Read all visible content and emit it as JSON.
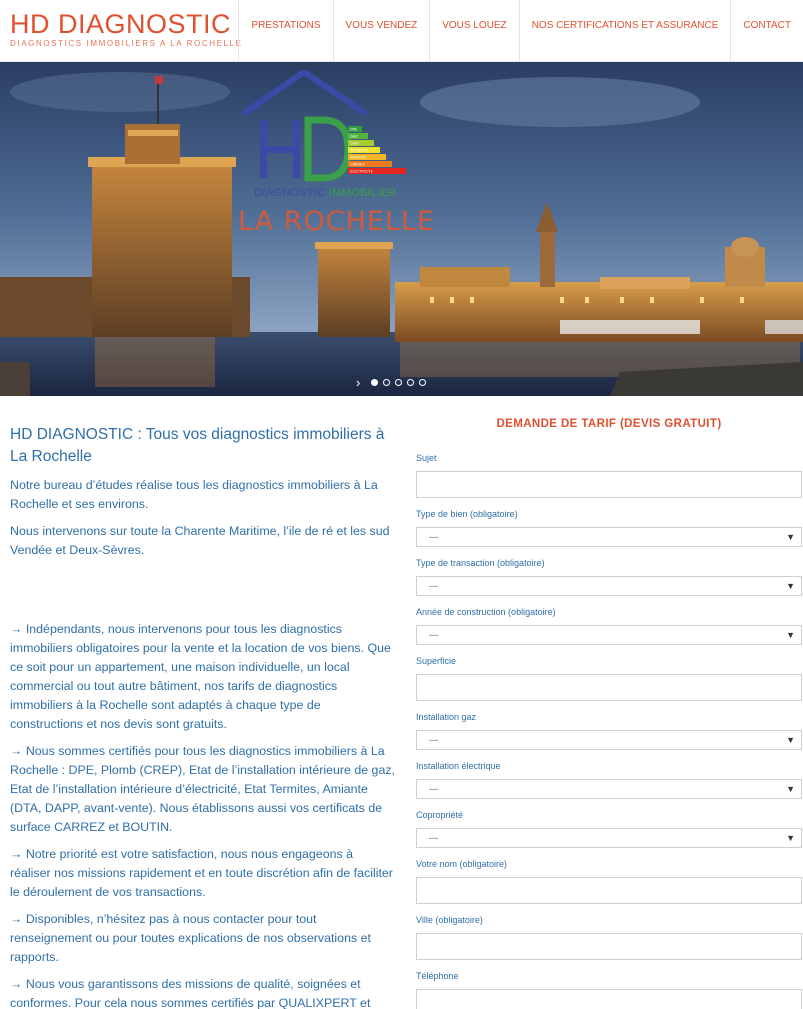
{
  "brand": {
    "title": "HD DIAGNOSTIC",
    "subtitle": "DIAGNOSTICS IMMOBILIERS A LA ROCHELLE"
  },
  "nav": {
    "items": [
      {
        "label": "PRESTATIONS"
      },
      {
        "label": "VOUS VENDEZ"
      },
      {
        "label": "VOUS LOUEZ"
      },
      {
        "label": "NOS CERTIFICATIONS ET ASSURANCE"
      },
      {
        "label": "CONTACT"
      }
    ]
  },
  "hero": {
    "logo_letters": "HD",
    "logo_diag": "DIAGNOSTIC",
    "logo_imm": "IMMOBILIER",
    "logo_city": "LA ROCHELLE",
    "energy_labels": [
      "DPE",
      "GAZ",
      "CREP",
      "TERMITES",
      "AMIANTE",
      "CARREZ",
      "ELECTRICITE"
    ],
    "slider_arrow": "›",
    "slide_count": 5,
    "active_slide": 1
  },
  "content": {
    "heading": "HD DIAGNOSTIC : Tous vos diagnostics immobiliers à La Rochelle",
    "intro1": "Notre bureau d’études réalise tous les diagnostics immobiliers à La Rochelle et ses environs.",
    "intro2": "Nous intervenons sur toute la Charente Maritime, l’ile de ré et les sud Vendée et Deux-Sèvres.",
    "p1": "→ Indépendants, nous intervenons pour tous les diagnostics immobiliers obligatoires pour la vente et la location de vos biens. Que ce soit pour un appartement, une maison individuelle, un local commercial ou tout autre bâtiment, nos tarifs de diagnostics immobiliers à la Rochelle sont adaptés à chaque type de constructions et nos devis sont gratuits.",
    "p2": "→ Nous sommes certifiés pour tous les diagnostics immobiliers à La Rochelle : DPE, Plomb (CREP), Etat de l’installation intérieure de gaz, Etat de l’installation intérieure d’électricité, Etat Termites, Amiante (DTA, DAPP, avant-vente). Nous établissons aussi vos certificats de surface CARREZ et BOUTIN.",
    "p3": "→ Notre priorité est votre satisfaction, nous nous engageons à réaliser nos missions rapidement et en toute discrétion afin de faciliter le déroulement de vos transactions.",
    "p4": "→ Disponibles, n’hésitez pas à nous contacter pour tout renseignement ou pour toutes explications de nos observations et rapports.",
    "p5": "→ Nous vous garantissons des missions de qualité, soignées et conformes. Pour cela nous sommes certifiés par QUALIXPERT et"
  },
  "form": {
    "title": "DEMANDE DE TARIF (DEVIS GRATUIT)",
    "select_default": "---",
    "fields": [
      {
        "label": "Sujet"
      },
      {
        "label": "Type de bien (obligatoire)"
      },
      {
        "label": "Type de transaction (obligatoire)"
      },
      {
        "label": "Année de construction (obligatoire)"
      },
      {
        "label": "Superficie"
      },
      {
        "label": "Installation gaz"
      },
      {
        "label": "Installation électrique"
      },
      {
        "label": "Copropriété"
      },
      {
        "label": "Votre nom (obligatoire)"
      },
      {
        "label": "Ville (obligatoire)"
      },
      {
        "label": "Téléphone"
      }
    ]
  },
  "colors": {
    "accent": "#e0502f",
    "text_blue": "#2f6fa8"
  }
}
